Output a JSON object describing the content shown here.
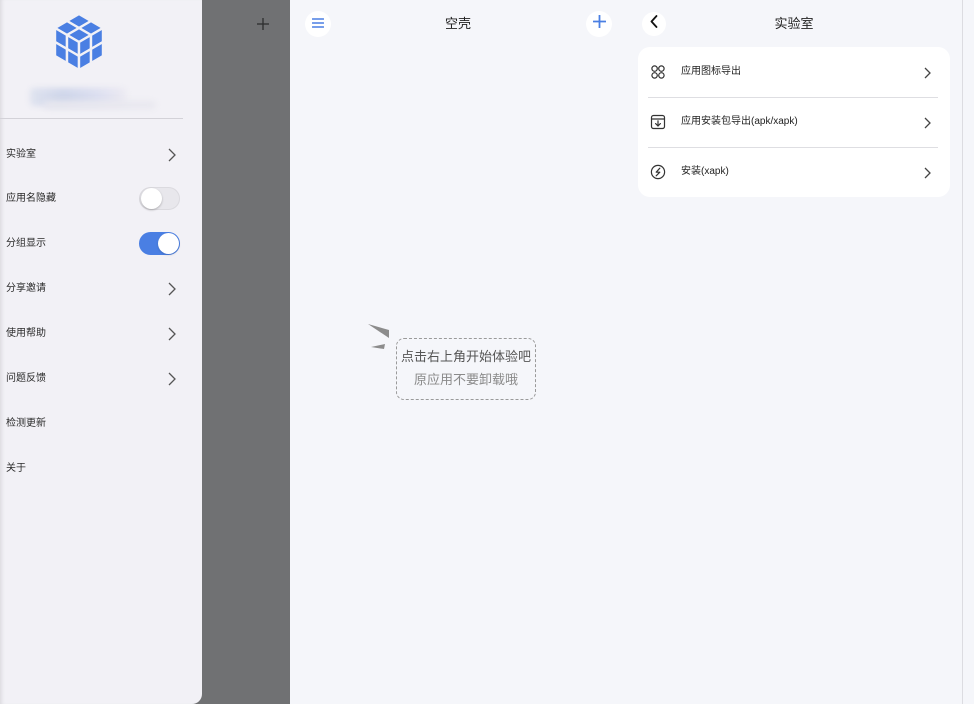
{
  "drawer": {
    "menu": [
      {
        "label": "实验室",
        "trailing_icon": "chevron-right-icon"
      },
      {
        "label": "应用名隐藏",
        "toggle_on": false
      },
      {
        "label": "分组显示",
        "toggle_on": true
      },
      {
        "label": "分享邀请",
        "trailing_icon": "chevron-right-icon"
      },
      {
        "label": "使用帮助",
        "trailing_icon": "chevron-right-icon"
      },
      {
        "label": "问题反馈",
        "trailing_icon": "chevron-right-icon"
      },
      {
        "label": "检测更新"
      },
      {
        "label": "关于"
      }
    ]
  },
  "main": {
    "title": "空壳",
    "left_icon": "menu-icon",
    "right_icon": "plus-icon",
    "empty_state": {
      "line1": "点击右上角开始体验吧",
      "line2": "原应用不要卸载哦"
    }
  },
  "lab": {
    "title": "实验室",
    "back_icon": "chevron-left-icon",
    "items": [
      {
        "label": "应用图标导出",
        "icon": "app-icon-grid-icon"
      },
      {
        "label": "应用安装包导出(apk/xapk)",
        "icon": "package-export-icon"
      },
      {
        "label": "安装(xapk)",
        "icon": "install-icon"
      }
    ]
  },
  "colors": {
    "accent": "#4a7fe3",
    "drawer_bg": "#f2f1f6",
    "scrim": "#707173",
    "page_bg": "#f5f6fa",
    "card_bg": "#ffffff"
  }
}
